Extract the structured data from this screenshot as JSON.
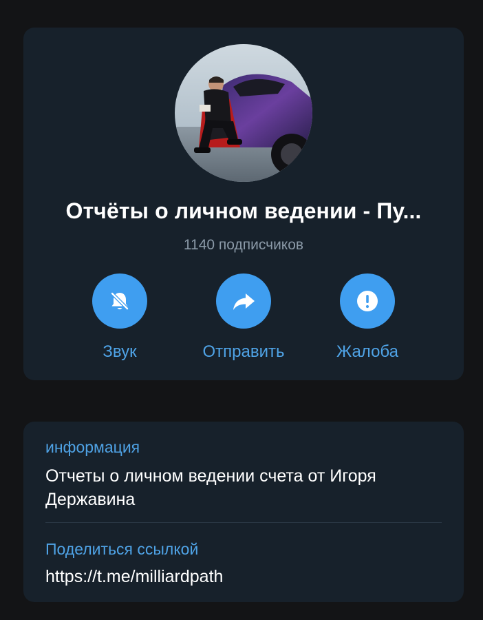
{
  "channel": {
    "title": "Отчёты о личном ведении - Пу...",
    "subscribers": "1140 подписчиков"
  },
  "actions": [
    {
      "label": "Звук",
      "icon": "muted-bell-icon"
    },
    {
      "label": "Отправить",
      "icon": "share-arrow-icon"
    },
    {
      "label": "Жалоба",
      "icon": "exclamation-icon"
    }
  ],
  "info": {
    "about_label": "информация",
    "about_text": "Отчеты о личном ведении счета от Игоря Державина",
    "link_label": "Поделиться ссылкой",
    "link_value": "https://t.me/milliardpath"
  },
  "colors": {
    "background": "#131416",
    "card": "#17212b",
    "accent": "#4fa3e6",
    "action_circle": "#3f9ef0",
    "secondary_text": "#8b9aa8"
  }
}
